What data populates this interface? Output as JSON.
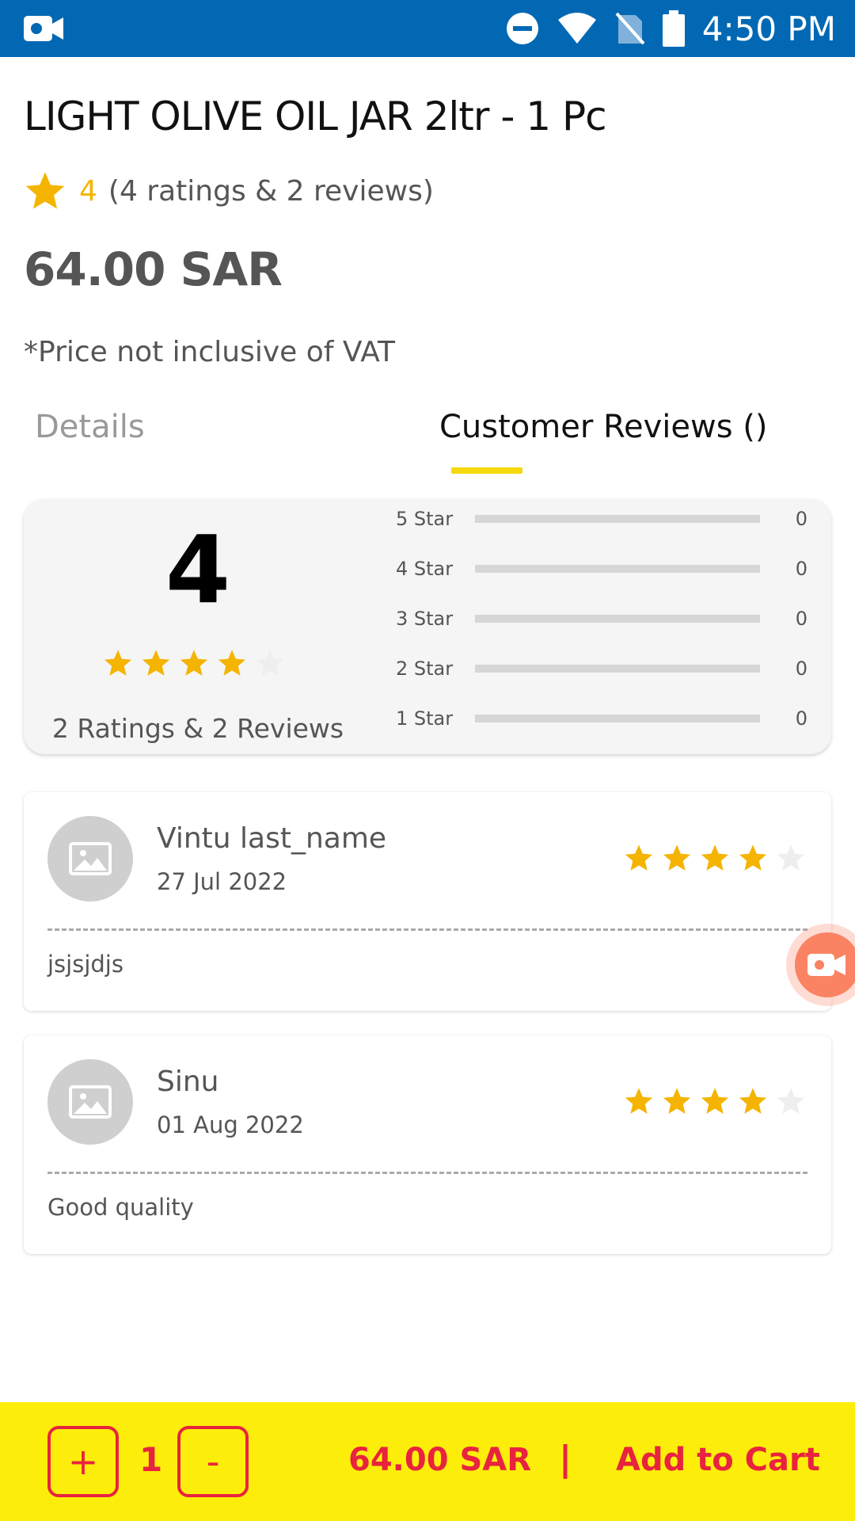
{
  "status_bar": {
    "time": "4:50 PM",
    "icons": [
      "video-camera-icon",
      "do-not-disturb-icon",
      "wifi-icon",
      "no-sim-icon",
      "battery-icon"
    ]
  },
  "product": {
    "title": "LIGHT OLIVE OIL JAR 2ltr - 1 Pc",
    "rating": "4",
    "rating_summary": "(4 ratings & 2 reviews)",
    "price": "64.00 SAR",
    "vat_note": "*Price not inclusive of VAT"
  },
  "tabs": [
    {
      "label": "Details",
      "active": false
    },
    {
      "label": "Customer Reviews ()",
      "active": true
    }
  ],
  "summary": {
    "average": "4",
    "stars_filled": 4,
    "stars_total": 5,
    "count_text": "2 Ratings & 2 Reviews",
    "distribution": [
      {
        "label": "5 Star",
        "count": "0",
        "fraction": 0
      },
      {
        "label": "4 Star",
        "count": "0",
        "fraction": 0
      },
      {
        "label": "3 Star",
        "count": "0",
        "fraction": 0
      },
      {
        "label": "2 Star",
        "count": "0",
        "fraction": 0
      },
      {
        "label": "1 Star",
        "count": "0",
        "fraction": 0
      }
    ]
  },
  "reviews": [
    {
      "name": "Vintu  last_name",
      "date": "27 Jul 2022",
      "stars_filled": 4,
      "text": "jsjsjdjs"
    },
    {
      "name": "Sinu",
      "date": "01 Aug 2022",
      "stars_filled": 4,
      "text": "Good quality"
    }
  ],
  "cart": {
    "plus_label": "+",
    "quantity": "1",
    "minus_label": "-",
    "price": "64.00 SAR",
    "separator": "|",
    "add_label": "Add to Cart"
  },
  "colors": {
    "status_bar": "#0268b3",
    "star": "#f4b400",
    "star_empty": "#eeeeee",
    "tab_underline": "#f5d90b",
    "bottom_bar": "#fcee0a",
    "accent_red": "#e8233f",
    "record_button": "#fa8363"
  }
}
